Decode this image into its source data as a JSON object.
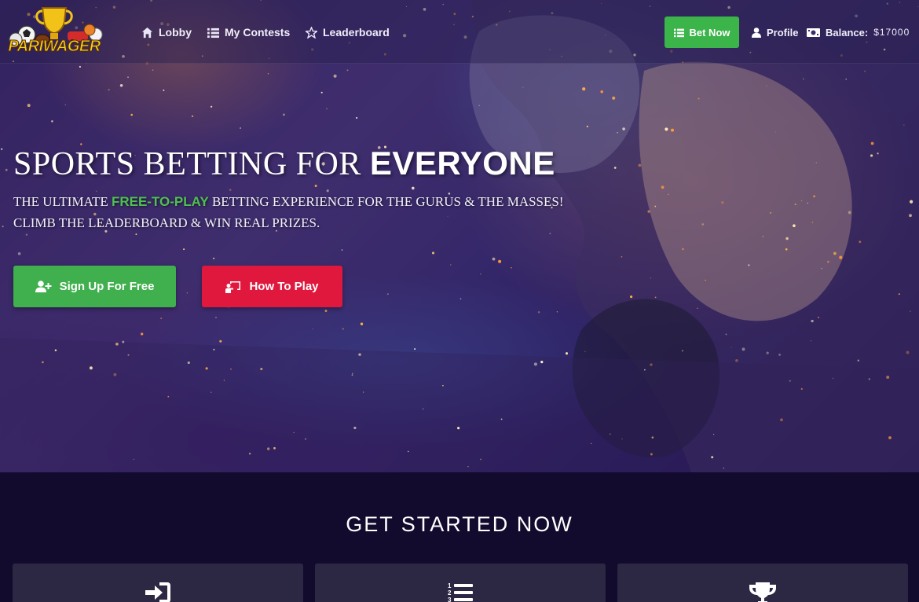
{
  "brand": {
    "logo_text": "PARIWAGER"
  },
  "nav": {
    "lobby": "Lobby",
    "my_contests": "My Contests",
    "leaderboard": "Leaderboard",
    "bet_now": "Bet Now",
    "profile": "Profile",
    "balance_label": "Balance:",
    "balance_value": "$17000"
  },
  "hero": {
    "headline_light": "SPORTS BETTING FOR ",
    "headline_bold": "EVERYONE",
    "sub_line1_prefix": "THE ULTIMATE ",
    "sub_line1_highlight": "FREE-TO-PLAY",
    "sub_line1_suffix": " BETTING EXPERIENCE FOR THE GURUS & THE MASSES!",
    "sub_line2": "CLIMB THE LEADERBOARD & WIN REAL PRIZES.",
    "signup_button": "Sign Up For Free",
    "howto_button": "How To Play"
  },
  "get_started": {
    "title": "GET STARTED NOW",
    "cards": [
      {
        "icon": "sign-in-icon"
      },
      {
        "icon": "numbered-list-icon"
      },
      {
        "icon": "trophy-icon"
      }
    ]
  },
  "colors": {
    "accent_green": "#3bb44a",
    "accent_red": "#e0183e",
    "highlight_green": "#4fc150",
    "page_background": "#120b2e",
    "card_background": "#2c2743"
  }
}
